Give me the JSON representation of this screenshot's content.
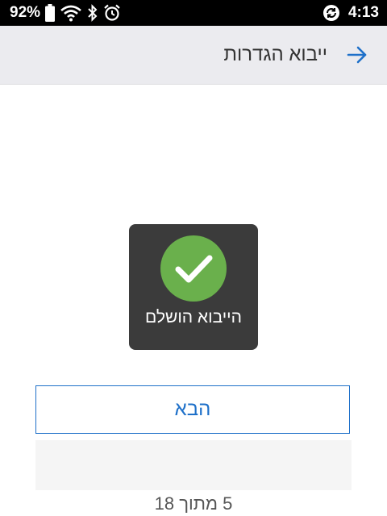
{
  "status_bar": {
    "battery_percent": "92%",
    "time": "4:13",
    "icons": [
      "battery-icon",
      "wifi-icon",
      "bluetooth-icon",
      "alarm-icon",
      "sync-icon"
    ]
  },
  "header": {
    "title": "ייבוא הגדרות",
    "back_icon": "arrow-right-icon"
  },
  "toast": {
    "icon": "check-circle-icon",
    "message": "הייבוא הושלם"
  },
  "footer": {
    "next_label": "הבא",
    "progress": "5 מתוך 18"
  },
  "colors": {
    "accent": "#1e70c9",
    "success": "#6ab04c",
    "toast_bg": "#3b3b3b",
    "header_bg": "#ebebef"
  }
}
